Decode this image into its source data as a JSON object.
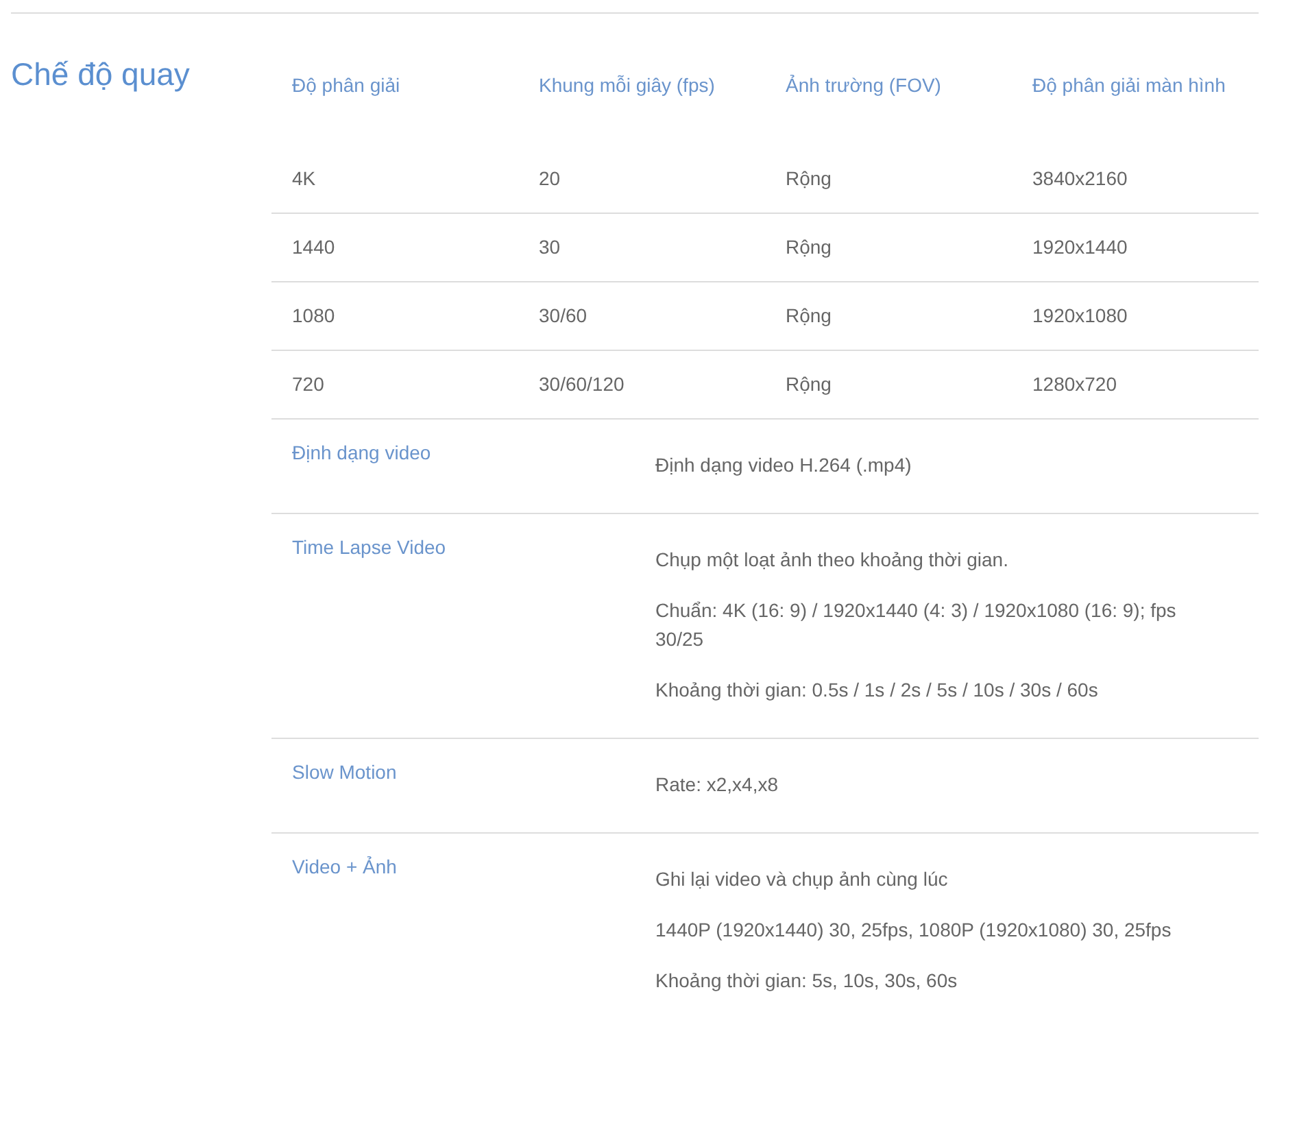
{
  "section_title": "Chế độ quay",
  "resolution_table": {
    "columns": [
      "Độ phân giải",
      "Khung mỗi giây (fps)",
      "Ảnh trường (FOV)",
      "Độ phân giải màn hình"
    ],
    "rows": [
      [
        "4K",
        "20",
        "Rộng",
        "3840x2160"
      ],
      [
        "1440",
        "30",
        "Rộng",
        "1920x1440"
      ],
      [
        "1080",
        "30/60",
        "Rộng",
        "1920x1080"
      ],
      [
        "720",
        "30/60/120",
        "Rộng",
        "1280x720"
      ]
    ]
  },
  "specs": [
    {
      "label": "Định dạng video",
      "lines": [
        "Định dạng video H.264 (.mp4)"
      ]
    },
    {
      "label": "Time Lapse Video",
      "lines": [
        "Chụp một loạt ảnh theo khoảng thời gian.",
        "Chuẩn: 4K (16: 9) / 1920x1440 (4: 3) / 1920x1080 (16: 9); fps 30/25",
        "Khoảng thời gian: 0.5s / 1s / 2s / 5s / 10s / 30s / 60s"
      ]
    },
    {
      "label": "Slow Motion",
      "lines": [
        "Rate: x2,x4,x8"
      ]
    },
    {
      "label": "Video + Ảnh",
      "lines": [
        "Ghi lại video và chụp ảnh cùng lúc",
        "1440P (1920x1440) 30, 25fps, 1080P (1920x1080) 30, 25fps",
        "Khoảng thời gian: 5s, 10s, 30s, 60s"
      ]
    }
  ]
}
